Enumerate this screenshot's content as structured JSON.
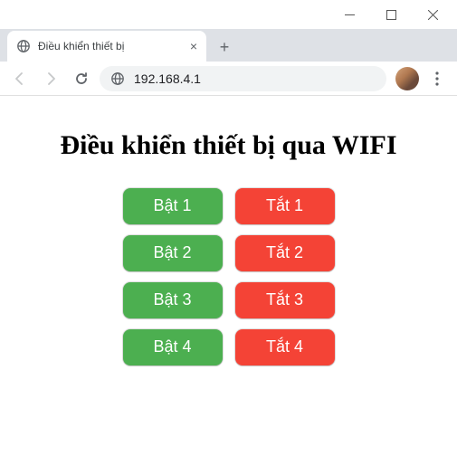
{
  "browser": {
    "tab_title": "Điều khiển thiết bị",
    "address": "192.168.4.1",
    "new_tab_symbol": "+",
    "close_symbol": "×"
  },
  "page": {
    "heading": "Điều khiển thiết bị qua WIFI"
  },
  "buttons": {
    "row1_on": "Bật 1",
    "row1_off": "Tắt 1",
    "row2_on": "Bật 2",
    "row2_off": "Tắt 2",
    "row3_on": "Bật 3",
    "row3_off": "Tắt 3",
    "row4_on": "Bật 4",
    "row4_off": "Tắt 4"
  },
  "colors": {
    "on": "#4caf50",
    "off": "#f44336"
  }
}
